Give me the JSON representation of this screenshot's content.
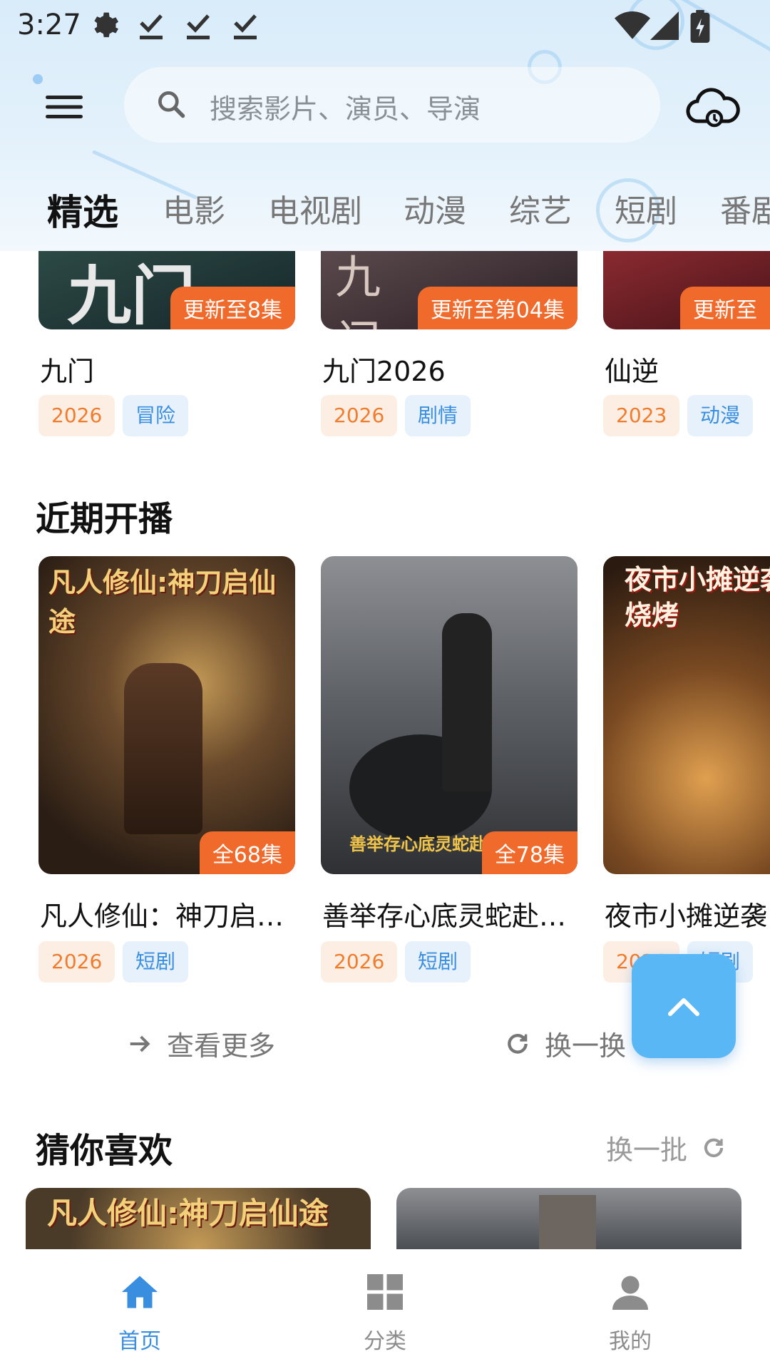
{
  "status_bar": {
    "time": "3:27"
  },
  "search": {
    "placeholder": "搜索影片、演员、导演"
  },
  "tabs": [
    "精选",
    "电影",
    "电视剧",
    "动漫",
    "综艺",
    "短剧",
    "番剧"
  ],
  "top_row": [
    {
      "title": "九门",
      "badge": "更新至8集",
      "year": "2026",
      "category": "冒险",
      "color": "#1f3a3a"
    },
    {
      "title": "九门2026",
      "badge": "更新至第04集",
      "year": "2026",
      "category": "剧情",
      "color": "#3a2a2e"
    },
    {
      "title": "仙逆",
      "badge": "更新至",
      "year": "2023",
      "category": "动漫",
      "color": "#5a1a20"
    }
  ],
  "upcoming": {
    "title": "近期开播",
    "items": [
      {
        "title": "凡人修仙：神刀启…",
        "poster_text": "凡人修仙:神刀启仙途",
        "badge": "全68集",
        "year": "2026",
        "category": "短剧",
        "color": "#4a3a28"
      },
      {
        "title": "善举存心底灵蛇赴…",
        "poster_text": "善举存心底灵蛇赴人间相助",
        "badge": "全78集",
        "year": "2026",
        "category": "短剧",
        "color": "#4b4e52"
      },
      {
        "title": "夜市小摊逆袭",
        "poster_text": "夜市小摊逆袭 连锁烧烤",
        "badge": "",
        "year": "2026",
        "category": "短剧",
        "color": "#3a2616"
      }
    ],
    "more_label": "查看更多",
    "refresh_label": "换一换"
  },
  "guess": {
    "title": "猜你喜欢",
    "refresh_label": "换一批",
    "items": [
      {
        "poster_text": "凡人修仙:神刀启仙途",
        "color": "#4a3a28"
      },
      {
        "poster_text": "",
        "color": "#4b4e52"
      }
    ]
  },
  "bottom_nav": [
    {
      "label": "首页",
      "icon": "home-icon",
      "active": true
    },
    {
      "label": "分类",
      "icon": "grid-icon",
      "active": false
    },
    {
      "label": "我的",
      "icon": "user-icon",
      "active": false
    }
  ],
  "colors": {
    "accent": "#3a8ee0",
    "badge": "#f06a2b",
    "fab": "#5ab7f5"
  }
}
